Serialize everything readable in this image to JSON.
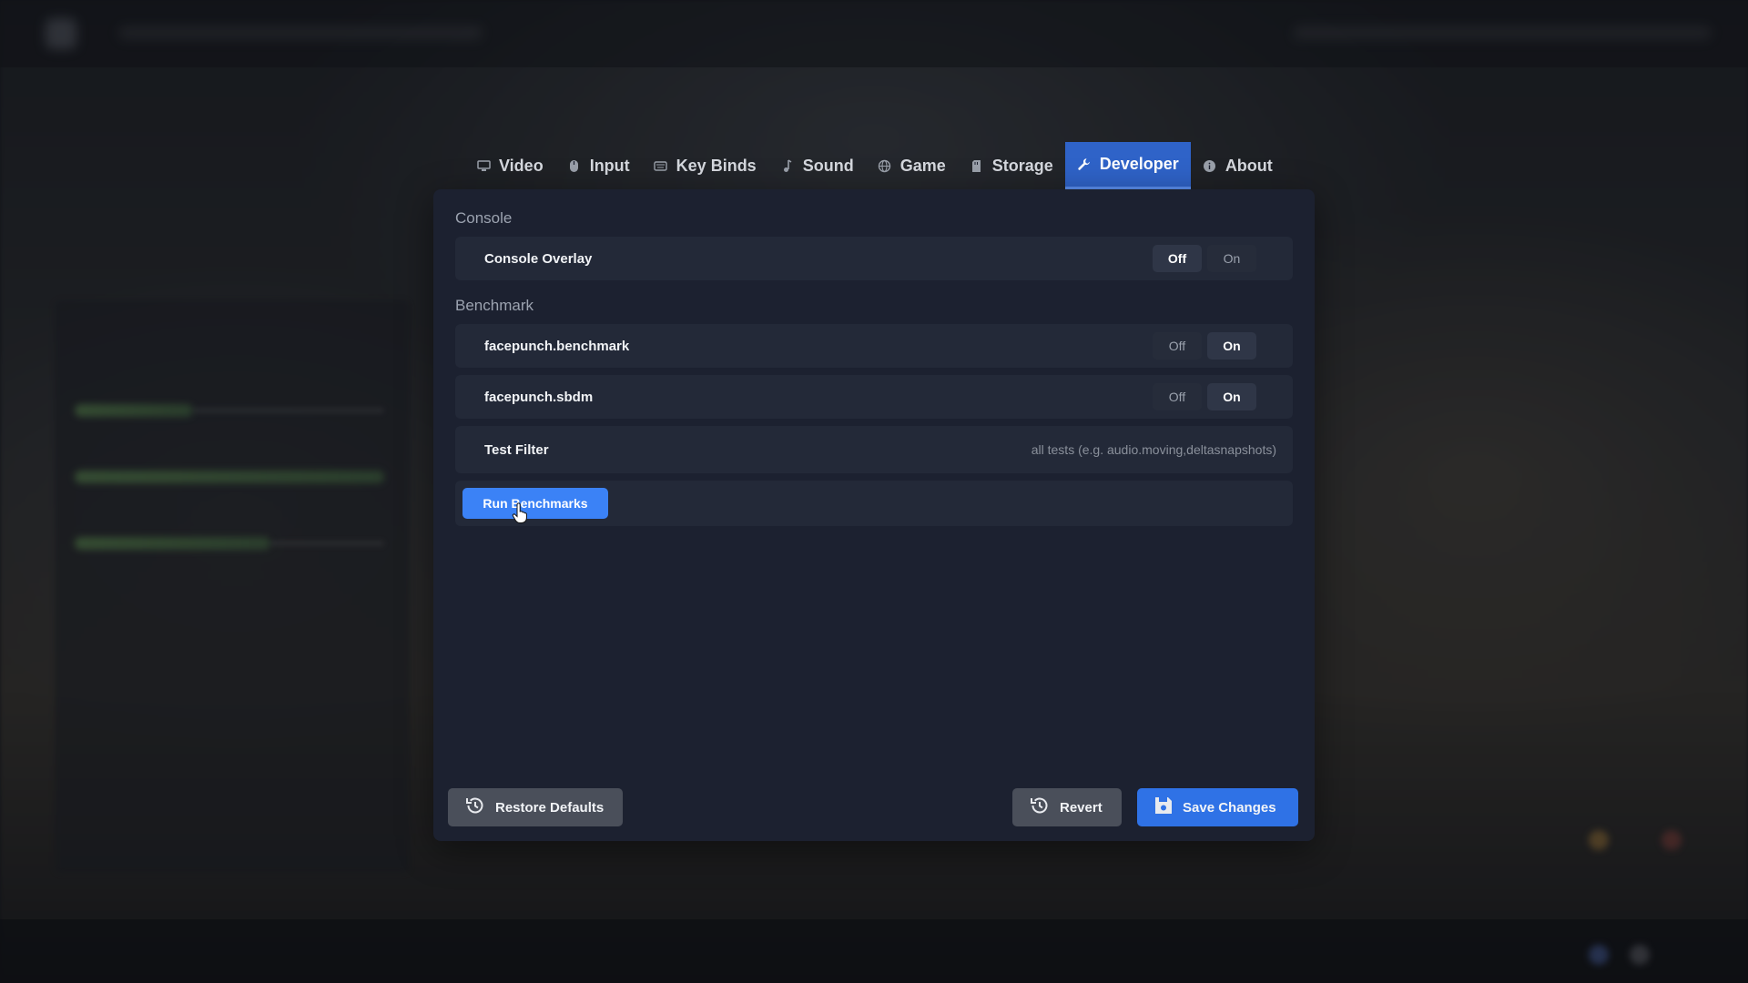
{
  "tabs": [
    {
      "label": "Video",
      "icon": "monitor-icon",
      "active": false
    },
    {
      "label": "Input",
      "icon": "mouse-icon",
      "active": false
    },
    {
      "label": "Key Binds",
      "icon": "keyboard-icon",
      "active": false
    },
    {
      "label": "Sound",
      "icon": "music-note-icon",
      "active": false
    },
    {
      "label": "Game",
      "icon": "globe-icon",
      "active": false
    },
    {
      "label": "Storage",
      "icon": "storage-icon",
      "active": false
    },
    {
      "label": "Developer",
      "icon": "wrench-icon",
      "active": true
    },
    {
      "label": "About",
      "icon": "info-icon",
      "active": false
    }
  ],
  "sections": {
    "console": {
      "title": "Console",
      "console_overlay": {
        "label": "Console Overlay",
        "off": "Off",
        "on": "On",
        "value": "Off"
      }
    },
    "benchmark": {
      "title": "Benchmark",
      "facepunch_benchmark": {
        "label": "facepunch.benchmark",
        "off": "Off",
        "on": "On",
        "value": "On"
      },
      "facepunch_sbdm": {
        "label": "facepunch.sbdm",
        "off": "Off",
        "on": "On",
        "value": "On"
      },
      "test_filter": {
        "label": "Test Filter",
        "placeholder": "all tests (e.g. audio.moving,deltasnapshots)"
      },
      "run_label": "Run Benchmarks"
    }
  },
  "footer": {
    "restore_label": "Restore Defaults",
    "revert_label": "Revert",
    "save_label": "Save Changes"
  },
  "colors": {
    "accent": "#3b82f6",
    "active_tab": "#2f63c8",
    "panel": "#1c2130",
    "row": "#232938"
  }
}
